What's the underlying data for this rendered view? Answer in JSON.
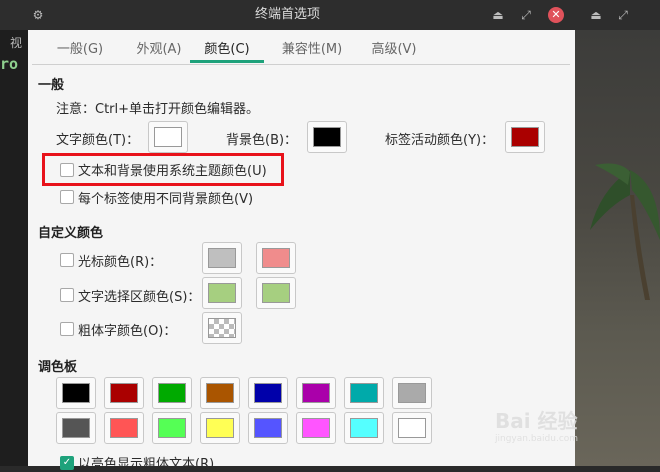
{
  "window": {
    "title": "终端首选项"
  },
  "background": {
    "text1": "视",
    "text2": "ro"
  },
  "tabs": [
    {
      "label": "一般(G)"
    },
    {
      "label": "外观(A)"
    },
    {
      "label": "颜色(C)"
    },
    {
      "label": "兼容性(M)"
    },
    {
      "label": "高级(V)"
    }
  ],
  "general": {
    "heading": "一般",
    "note": "注意：Ctrl+单击打开颜色编辑器。",
    "text_color_label": "文字颜色(T)：",
    "bg_color_label": "背景色(B)：",
    "tab_active_label": "标签活动颜色(Y)：",
    "text_color": "#ffffff",
    "bg_color": "#000000",
    "tab_active_color": "#aa0000",
    "use_system_theme": "文本和背景使用系统主题颜色(U)",
    "per_tab_bg": "每个标签使用不同背景颜色(V)"
  },
  "custom": {
    "heading": "自定义颜色",
    "cursor_label": "光标颜色(R)：",
    "cursor_colors": [
      "#bfbfbf",
      "#f08c8c"
    ],
    "selection_label": "文字选择区颜色(S)：",
    "selection_colors": [
      "#a6cf80",
      "#a6cf80"
    ],
    "bold_label": "粗体字颜色(O)："
  },
  "palette": {
    "heading": "调色板",
    "row1": [
      "#000000",
      "#aa0000",
      "#00aa00",
      "#aa5500",
      "#0000aa",
      "#aa00aa",
      "#00aaaa",
      "#aaaaaa"
    ],
    "row2": [
      "#555555",
      "#ff5555",
      "#55ff55",
      "#ffff55",
      "#5555ff",
      "#ff55ff",
      "#55ffff",
      "#ffffff"
    ],
    "bright_bold": "以亮色显示粗体文本(R)"
  },
  "watermark": {
    "text": "Bai 经验",
    "url": "jingyan.baidu.com"
  }
}
